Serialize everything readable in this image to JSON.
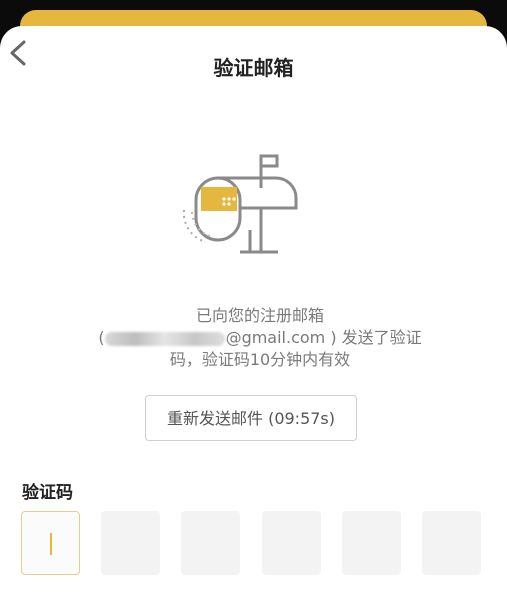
{
  "header": {
    "title": "验证邮箱",
    "back_icon": "chevron-left-icon"
  },
  "illustration": {
    "icon": "mailbox-icon",
    "accent_color": "#e6b73f"
  },
  "message": {
    "line1": "已向您的注册邮箱",
    "email_prefix": "(",
    "email_visible": "@gmail.com ) 发送了验证",
    "line3": "码，验证码10分钟内有效"
  },
  "resend": {
    "label": "重新发送邮件 (09:57s)"
  },
  "code": {
    "label": "验证码",
    "boxes": [
      "",
      "",
      "",
      "",
      "",
      ""
    ]
  }
}
